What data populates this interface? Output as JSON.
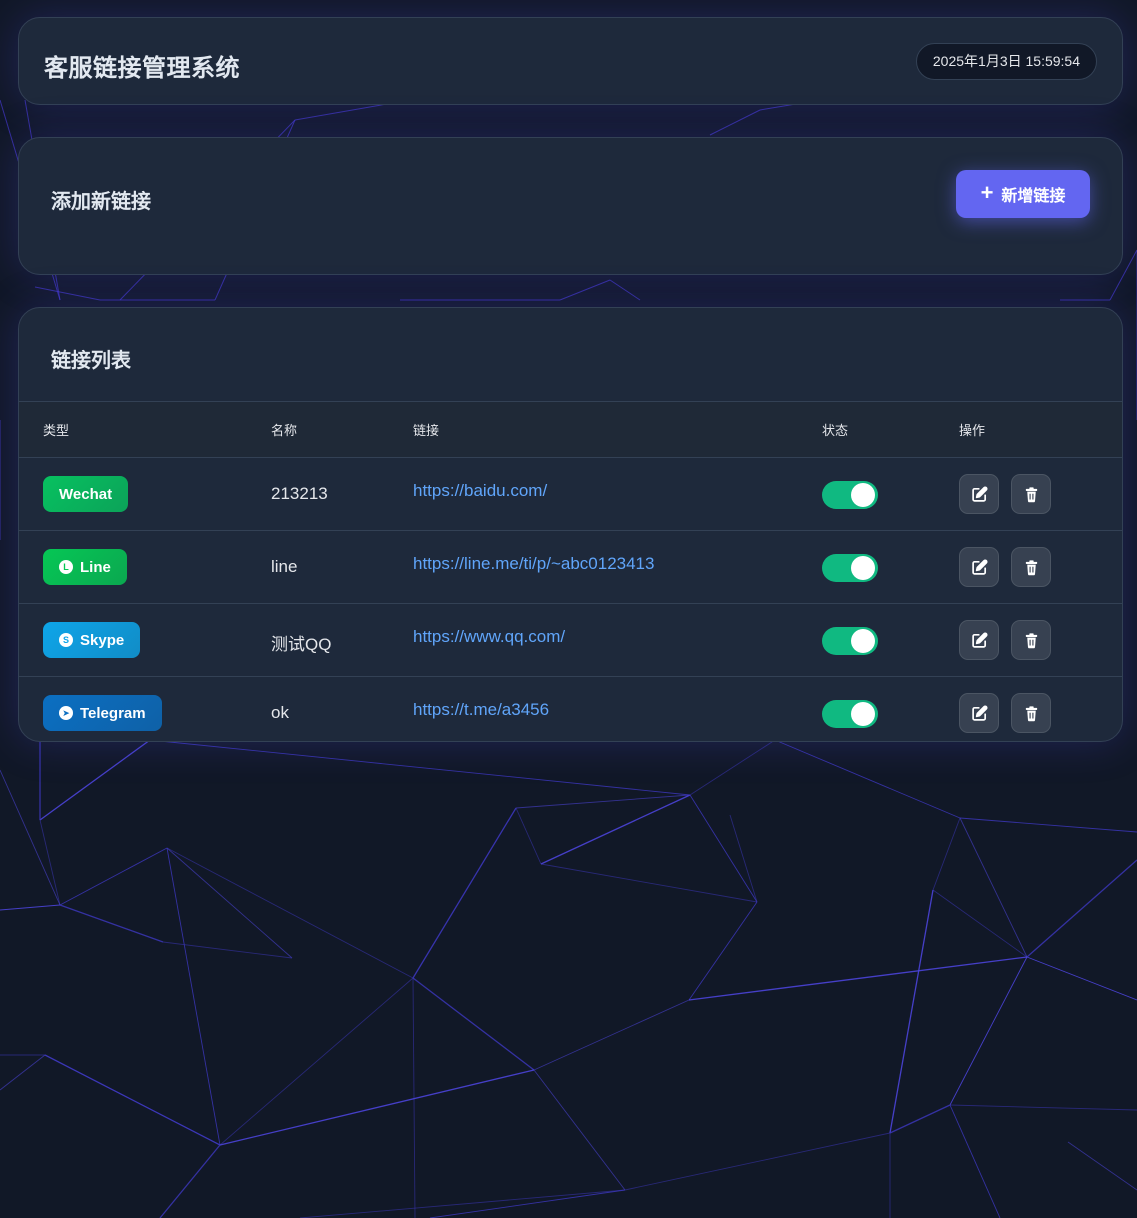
{
  "header": {
    "title": "客服链接管理系统",
    "datetime": "2025年1月3日 15:59:54"
  },
  "add_section": {
    "title": "添加新链接",
    "add_button_label": "新增链接",
    "add_button_icon": "plus-icon"
  },
  "list_section": {
    "title": "链接列表",
    "columns": [
      "类型",
      "名称",
      "链接",
      "状态",
      "操作"
    ],
    "rows": [
      {
        "type": "Wechat",
        "type_icon": "",
        "type_color": "#07c160",
        "name": "213213",
        "link": "https://baidu.com/",
        "enabled": true
      },
      {
        "type": "Line",
        "type_icon": "line-icon",
        "type_color": "#06c755",
        "name": "line",
        "link": "https://line.me/ti/p/~abc0123413",
        "enabled": true
      },
      {
        "type": "Skype",
        "type_icon": "skype-icon",
        "type_color": "#0ea5e9",
        "name": "测试QQ",
        "link": "https://www.qq.com/",
        "enabled": true
      },
      {
        "type": "Telegram",
        "type_icon": "telegram-icon",
        "type_color": "#0b6fc2",
        "name": "ok",
        "link": "https://t.me/a3456",
        "enabled": true
      }
    ]
  },
  "colors": {
    "background": "#111827",
    "card": "#1e293b",
    "accent": "#6366f1",
    "toggle_on": "#10b981",
    "link": "#60a5fa"
  }
}
